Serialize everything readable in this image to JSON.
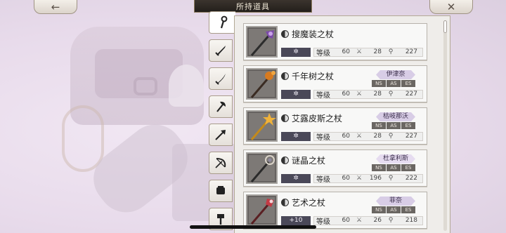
{
  "header": {
    "title": "所持道具",
    "back_icon": "←",
    "close_icon": "✕"
  },
  "tabs": [
    {
      "name": "staff",
      "active": true
    },
    {
      "name": "sword",
      "active": false
    },
    {
      "name": "blade",
      "active": false
    },
    {
      "name": "axe",
      "active": false
    },
    {
      "name": "arrow",
      "active": false
    },
    {
      "name": "bow",
      "active": false
    },
    {
      "name": "fist",
      "active": false
    },
    {
      "name": "hammer",
      "active": false
    }
  ],
  "level_label": "等级",
  "badge_labels": [
    "NS",
    "AS",
    "ES"
  ],
  "items": [
    {
      "name": "搜魔装之杖",
      "refine": "✲",
      "level": "60",
      "atk": "28",
      "mag": "227",
      "owner": ""
    },
    {
      "name": "千年树之杖",
      "refine": "✲",
      "level": "60",
      "atk": "28",
      "mag": "227",
      "owner": "伊津奈"
    },
    {
      "name": "艾露皮斯之杖",
      "refine": "✲",
      "level": "60",
      "atk": "28",
      "mag": "227",
      "owner": "枯岐那沃"
    },
    {
      "name": "谜晶之杖",
      "refine": "✲",
      "level": "60",
      "atk": "196",
      "mag": "222",
      "owner": "杜拿利斯"
    },
    {
      "name": "艺术之杖",
      "refine": "+10",
      "level": "60",
      "atk": "26",
      "mag": "218",
      "owner": "菲奈"
    }
  ],
  "colors": {
    "title_bar": "#231f1b",
    "refine_bg": "#4a4858",
    "tag_bg": "#d8cde6"
  }
}
